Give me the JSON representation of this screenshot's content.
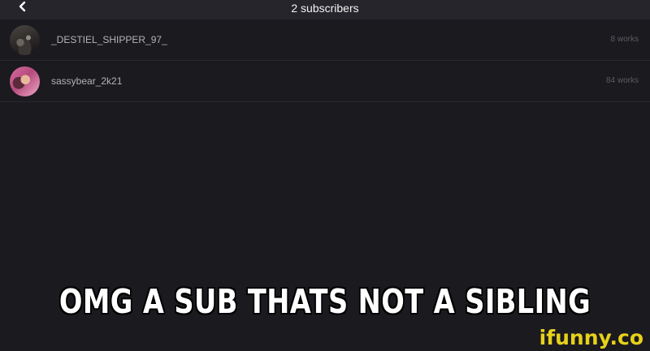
{
  "header": {
    "title": "2 subscribers",
    "back_icon": "chevron-left-icon"
  },
  "subscribers": [
    {
      "username": "_DESTIEL_SHIPPER_97_",
      "works": "8 works"
    },
    {
      "username": "sassybear_2k21",
      "works": "84 works"
    }
  ],
  "caption": "OMG A SUB THATS NOT A SIBLING",
  "watermark": "ifunny.co",
  "colors": {
    "background": "#1b1a1f",
    "header_background": "#26252c",
    "watermark": "#e6d11a"
  }
}
